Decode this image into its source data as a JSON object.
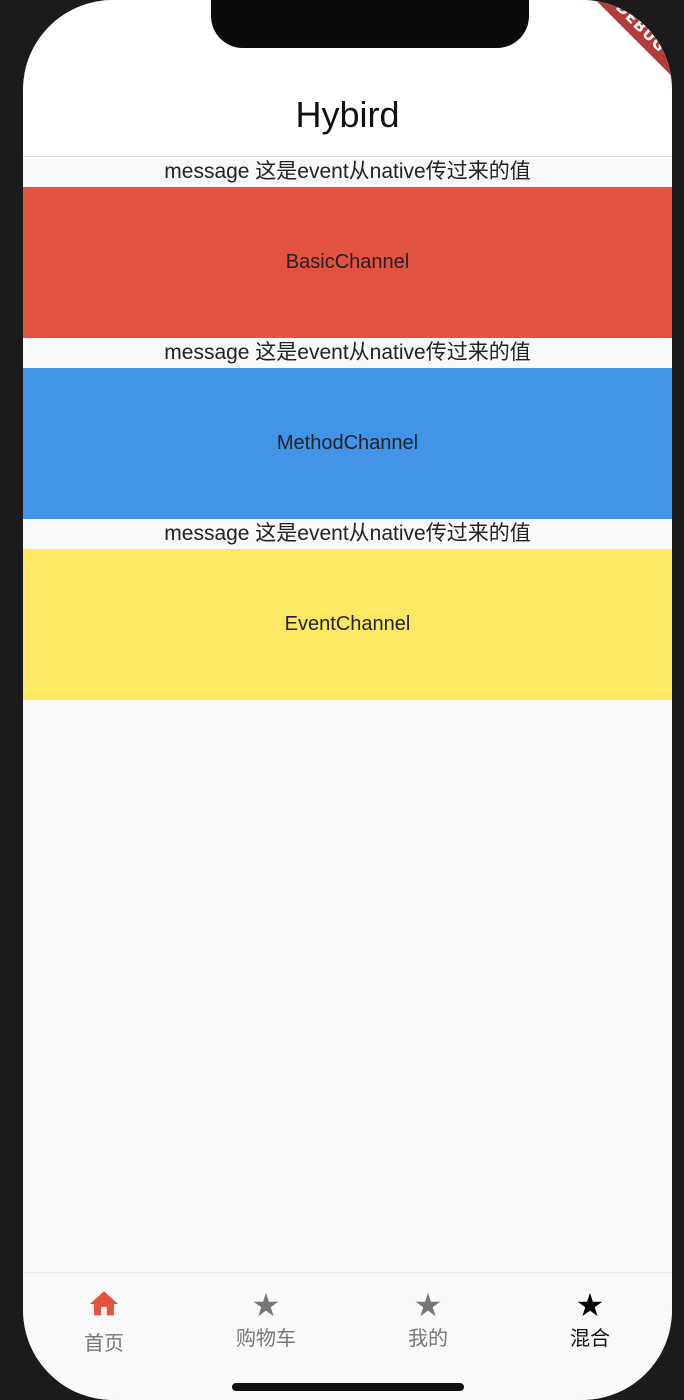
{
  "app_bar": {
    "title": "Hybird"
  },
  "debug_banner": "DEBUG",
  "sections": [
    {
      "message": "message 这是event从native传过来的值",
      "button_label": "BasicChannel",
      "color": "#e3533f"
    },
    {
      "message": "message 这是event从native传过来的值",
      "button_label": "MethodChannel",
      "color": "#4294e8"
    },
    {
      "message": "message 这是event从native传过来的值",
      "button_label": "EventChannel",
      "color": "#fde864"
    }
  ],
  "bottom_nav": {
    "items": [
      {
        "label": "首页",
        "icon": "home-icon",
        "color": "#e3533f",
        "label_color": "#777777"
      },
      {
        "label": "购物车",
        "icon": "star-icon",
        "color": "#777777",
        "label_color": "#777777"
      },
      {
        "label": "我的",
        "icon": "star-icon",
        "color": "#777777",
        "label_color": "#777777"
      },
      {
        "label": "混合",
        "icon": "star-icon",
        "color": "#000000",
        "label_color": "#111111"
      }
    ],
    "selected_label": "混合"
  }
}
